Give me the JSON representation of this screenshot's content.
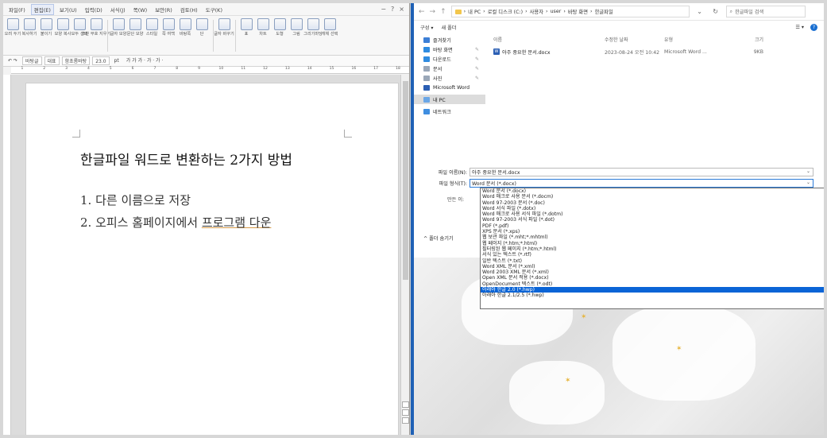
{
  "hwp": {
    "menus": [
      "파일(F)",
      "편집(E)",
      "보기(U)",
      "입력(D)",
      "서식(J)",
      "쪽(W)",
      "보안(R)",
      "검토(H)",
      "도구(K)"
    ],
    "active_menu": "편집(E)",
    "ribbon": [
      {
        "icon": "cut-icon",
        "label": "오려 두기"
      },
      {
        "icon": "copy-icon",
        "label": "복사하기"
      },
      {
        "icon": "paste-icon",
        "label": "붙이기"
      },
      {
        "icon": "format-copy-icon",
        "label": "모양 복사"
      },
      {
        "icon": "select-all-icon",
        "label": "모두 선택"
      },
      {
        "icon": "clear-format-icon",
        "label": "조판 부호 지우기"
      },
      {
        "icon": "char-shape-icon",
        "label": "글자 모양"
      },
      {
        "icon": "para-shape-icon",
        "label": "문단 모양"
      },
      {
        "icon": "style-icon",
        "label": "스타일"
      },
      {
        "icon": "layout-icon",
        "label": "쪽 여백"
      },
      {
        "icon": "column-icon",
        "label": "바탕쪽"
      },
      {
        "icon": "split-icon",
        "label": "단"
      },
      {
        "icon": "text-convert-icon",
        "label": "글자 바꾸기"
      },
      {
        "icon": "table-icon",
        "label": "표"
      },
      {
        "icon": "chart-icon",
        "label": "차트"
      },
      {
        "icon": "shape-icon",
        "label": "도형"
      },
      {
        "icon": "picture-icon",
        "label": "그림"
      },
      {
        "icon": "draw-icon",
        "label": "그리기마당"
      },
      {
        "icon": "select-object-icon",
        "label": "개체 선택"
      }
    ],
    "toolbar2": {
      "style": "바탕글",
      "para": "대표",
      "font": "함초롬바탕",
      "size": "23.0",
      "unit": "pt",
      "bold_glyphs": "가 가 가 · 가 · 가 ·"
    },
    "ruler_marks": [
      "1",
      "2",
      "3",
      "4",
      "5",
      "6",
      "7",
      "8",
      "9",
      "10",
      "11",
      "12",
      "13",
      "14",
      "15",
      "16",
      "17",
      "18"
    ],
    "doc": {
      "title": "한글파일 워드로 변환하는 2가지 방법",
      "line1": "1. 다른 이름으로 저장",
      "line2_prefix": "2. 오피스 홈페이지에서 ",
      "line2_underlined": "프로그램 다운"
    }
  },
  "dialog": {
    "path": [
      "내 PC",
      "로컬 디스크 (C:)",
      "사용자",
      "user",
      "바탕 화면",
      "한글파일"
    ],
    "search_placeholder": "한글파일 검색",
    "organize": "구성 ▾",
    "new_folder": "새 폴더",
    "nav": [
      {
        "label": "즐겨찾기",
        "icon": "star-icon",
        "pin": false,
        "selected": false
      },
      {
        "label": "바탕 화면",
        "icon": "desktop-icon",
        "pin": true,
        "selected": false
      },
      {
        "label": "다운로드",
        "icon": "download-icon",
        "pin": true,
        "selected": false
      },
      {
        "label": "문서",
        "icon": "document-icon",
        "pin": true,
        "selected": false
      },
      {
        "label": "사진",
        "icon": "picture-icon",
        "pin": true,
        "selected": false
      },
      {
        "label": "Microsoft Word",
        "icon": "word-icon",
        "pin": false,
        "selected": false
      },
      {
        "label": "내 PC",
        "icon": "pc-icon",
        "pin": false,
        "selected": true
      },
      {
        "label": "네트워크",
        "icon": "network-icon",
        "pin": false,
        "selected": false
      }
    ],
    "columns": {
      "name": "이름",
      "date": "수정한 날짜",
      "type": "유형",
      "size": "크기"
    },
    "file": {
      "name": "아주 중요한 문서.docx",
      "date": "2023-08-24 오전 10:42",
      "type": "Microsoft Word ...",
      "size": "9KB"
    },
    "filename_label": "파일 이름(N):",
    "filename_value": "아주 중요한 문서.docx",
    "filetype_label": "파일 형식(T):",
    "filetype_value": "Word 문서 (*.docx)",
    "author_label": "만든 이:",
    "hide_folders": "^ 폴더 숨기기",
    "types": [
      "Word 문서 (*.docx)",
      "Word 매크로 사용 문서 (*.docm)",
      "Word 97-2003 문서 (*.doc)",
      "Word 서식 파일 (*.dotx)",
      "Word 매크로 사용 서식 파일 (*.dotm)",
      "Word 97-2003 서식 파일 (*.dot)",
      "PDF (*.pdf)",
      "XPS 문서 (*.xps)",
      "웹 보관 파일 (*.mht;*.mhtml)",
      "웹 페이지 (*.htm;*.html)",
      "필터링된 웹 페이지 (*.htm;*.html)",
      "서식 있는 텍스트 (*.rtf)",
      "일반 텍스트 (*.txt)",
      "Word XML 문서 (*.xml)",
      "Word 2003 XML 문서 (*.xml)",
      "Open XML 문서 적용 (*.docx)",
      "OpenDocument 텍스트 (*.odt)",
      "아래아 한글 2.0 (*.hwp)",
      "아래아 한글 2.1/2.5 (*.hwp)"
    ],
    "highlighted_type": "아래아 한글 2.0 (*.hwp)"
  }
}
